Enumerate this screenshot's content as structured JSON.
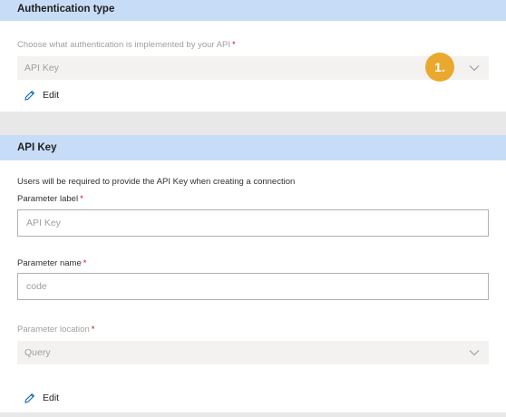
{
  "auth_section": {
    "title": "Authentication type",
    "select_label": "Choose what authentication is implemented by your API",
    "required_mark": "*",
    "select_value": "API Key",
    "badge": "1.",
    "edit_label": "Edit"
  },
  "apikey_section": {
    "title": "API Key",
    "description": "Users will be required to provide the API Key when creating a connection",
    "param_label": {
      "label": "Parameter label",
      "required_mark": "*",
      "placeholder": "API Key"
    },
    "param_name": {
      "label": "Parameter name",
      "required_mark": "*",
      "placeholder": "code"
    },
    "param_location": {
      "label": "Parameter location",
      "required_mark": "*",
      "value": "Query"
    },
    "edit_label": "Edit"
  },
  "icons": [
    "mouse-cursor-icon",
    "chevron-down-icon",
    "pencil-icon"
  ],
  "colors": {
    "header_bg": "#c7dcf7",
    "badge": "#eaa92e",
    "required": "#c50f1f"
  }
}
